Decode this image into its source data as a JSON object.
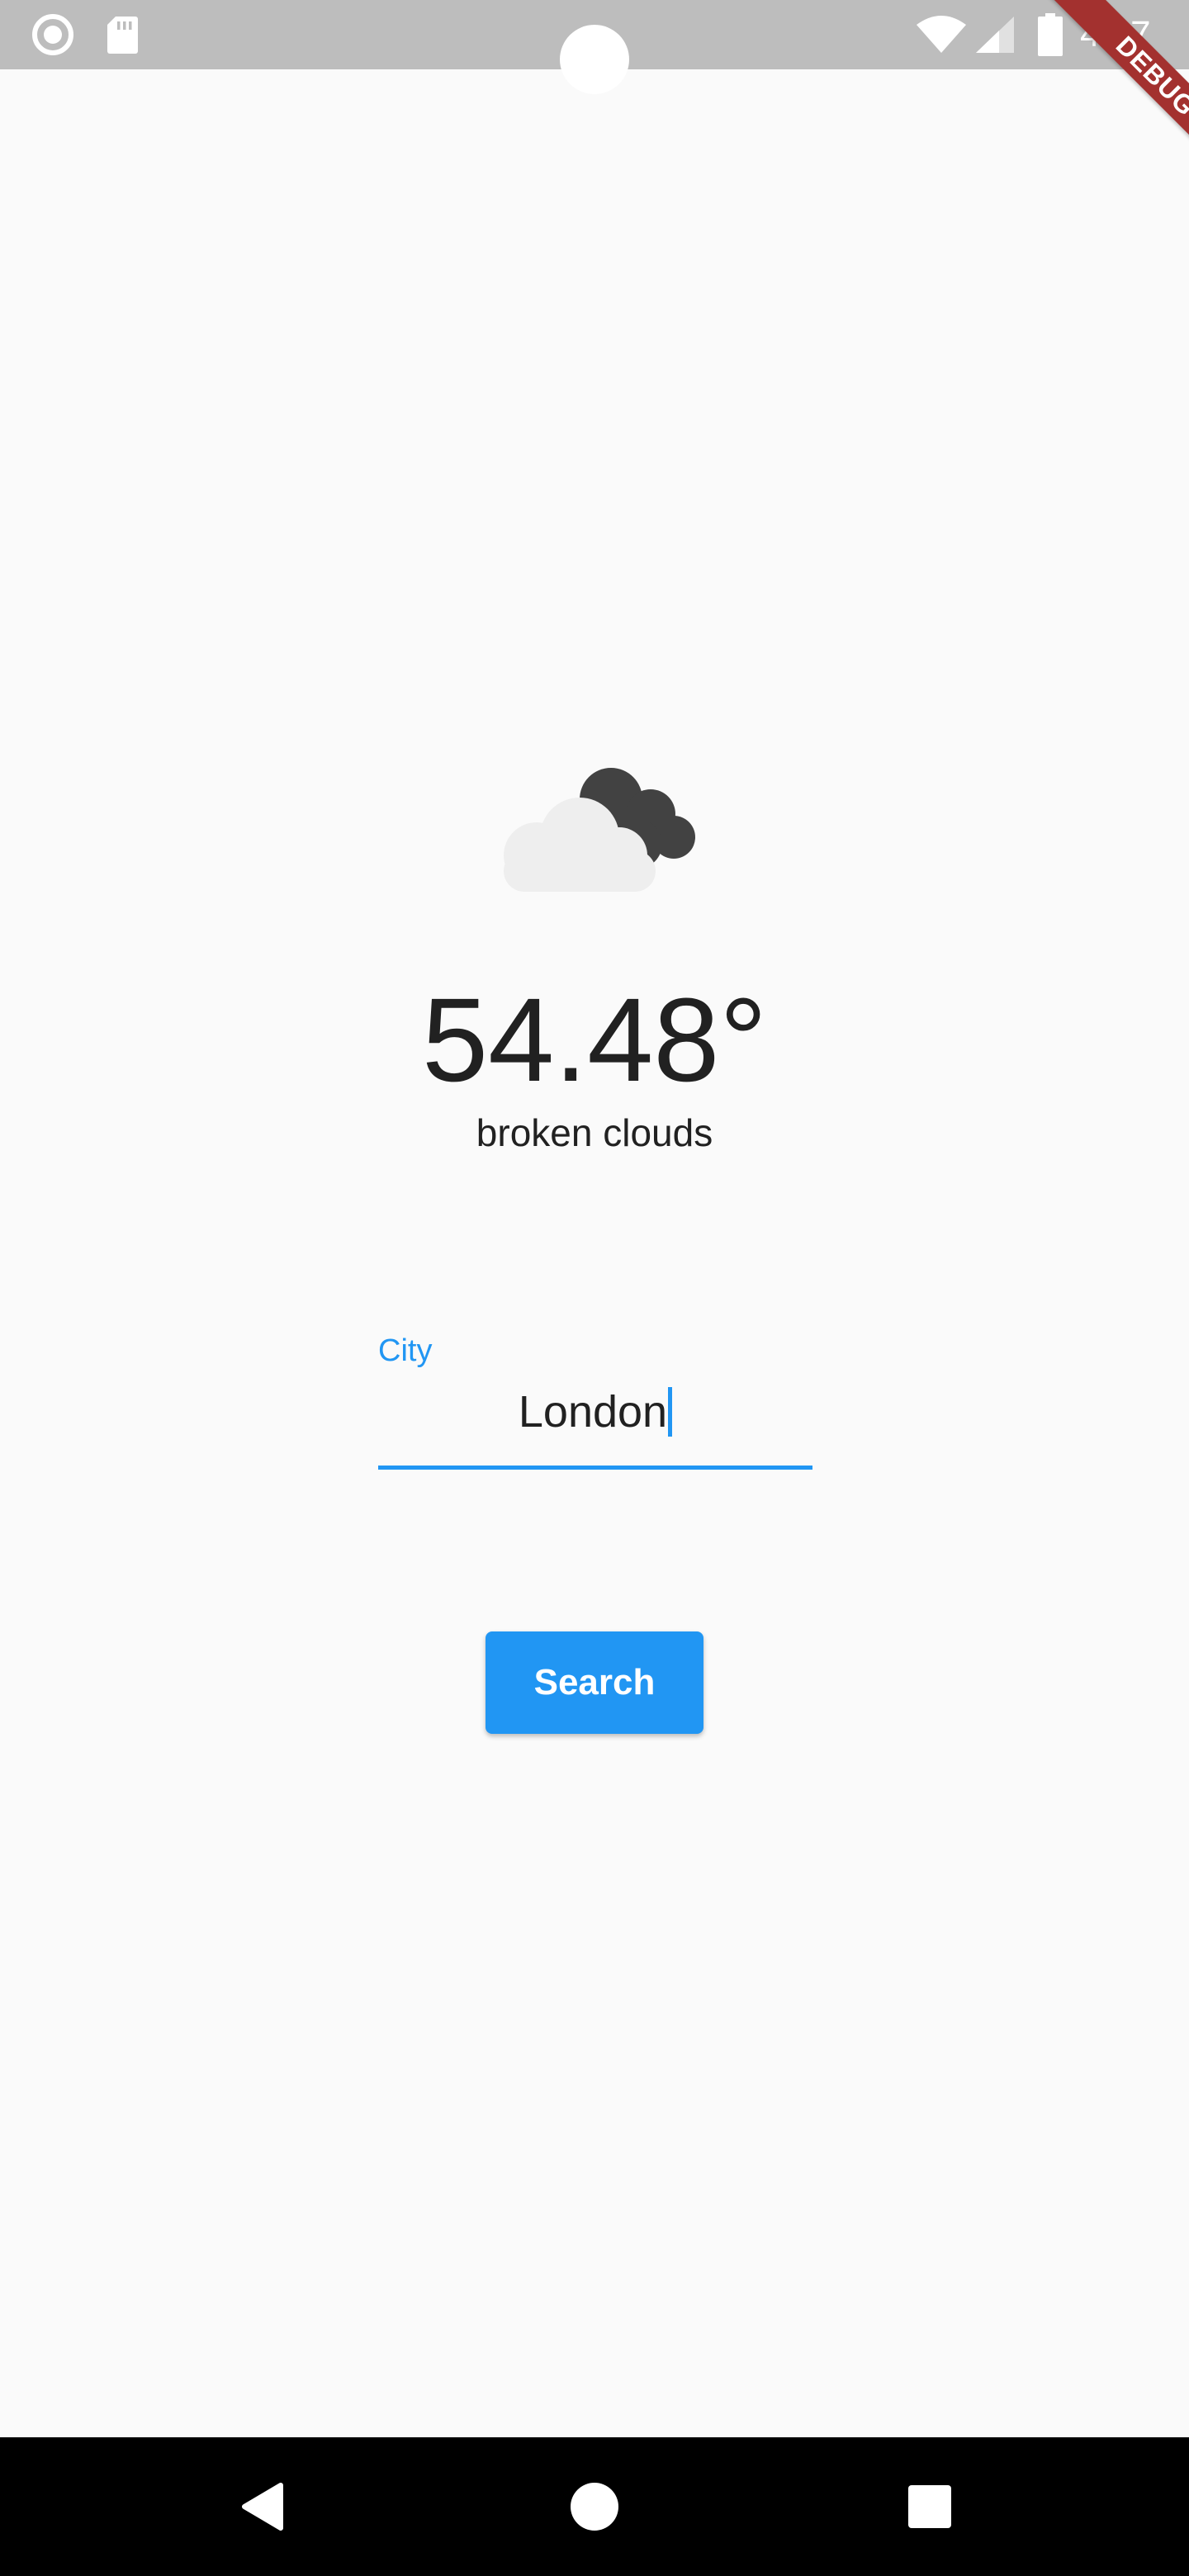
{
  "status_bar": {
    "time": "4:37",
    "left_icons": [
      "radio-button-icon",
      "sd-card-icon"
    ],
    "right_icons": [
      "wifi-icon",
      "signal-icon",
      "battery-icon"
    ]
  },
  "debug_banner": {
    "label": "DEBUG"
  },
  "weather": {
    "icon": "broken-clouds-icon",
    "temperature": "54.48°",
    "description": "broken clouds"
  },
  "city_field": {
    "label": "City",
    "value": "London"
  },
  "search_button": {
    "label": "Search"
  },
  "nav_bar": {
    "buttons": [
      "back-icon",
      "home-icon",
      "recents-icon"
    ]
  },
  "colors": {
    "accent": "#2196f3",
    "background": "#fafafa",
    "status_bar": "#bdbdbd",
    "text": "#212121",
    "debug_banner": "#a3312f"
  }
}
